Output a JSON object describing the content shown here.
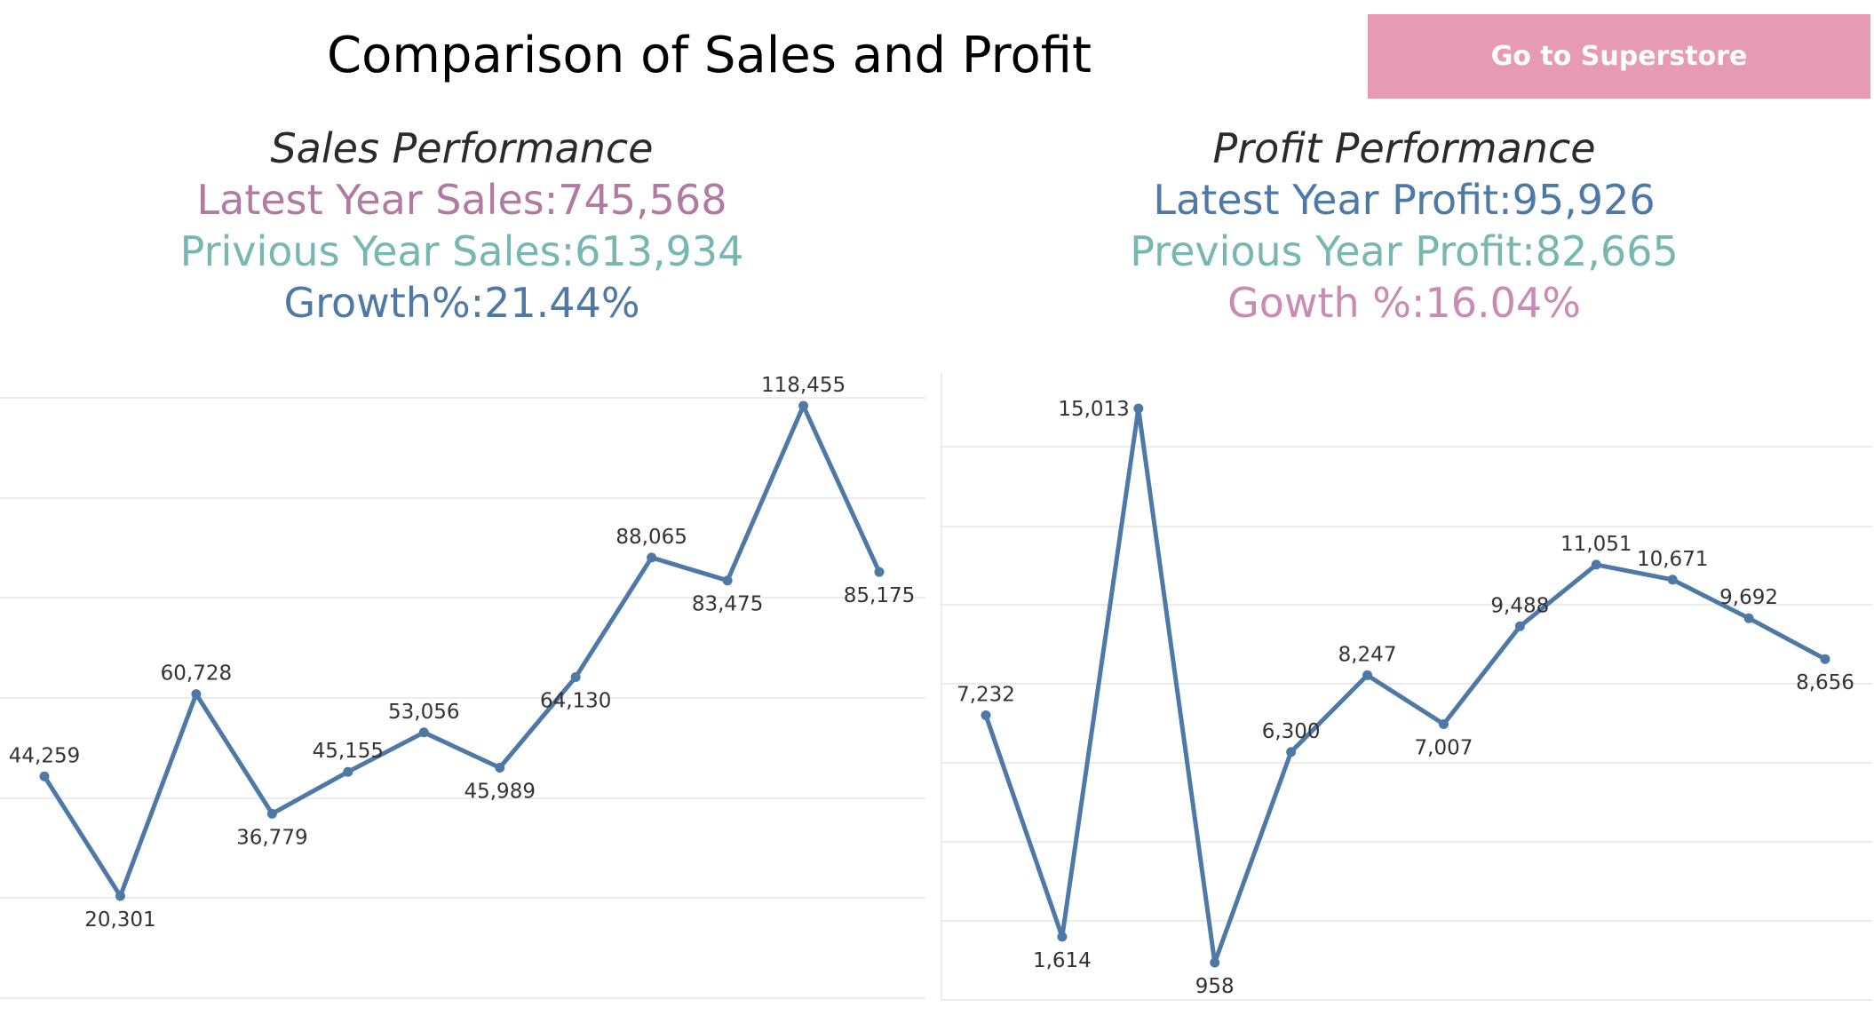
{
  "title": "Comparison of Sales and Profit",
  "nav_button": {
    "label": "Go to Superstore"
  },
  "colors": {
    "line": "#4e79a7",
    "pink": "#b07aa1",
    "teal": "#76b7b2",
    "blue": "#4e79a7",
    "light_pink": "#c98bb4",
    "button": "#e79ab3",
    "grid": "#e6e6e6"
  },
  "sales": {
    "heading": "Sales Performance",
    "latest": "Latest Year Sales:745,568",
    "previous": "Privious Year Sales:613,934",
    "growth": "Growth%:21.44%"
  },
  "profit": {
    "heading": "Profit Performance",
    "latest": "Latest Year Profit:95,926",
    "previous": "Previous Year Profit:82,665",
    "growth": "Gowth %:16.04%"
  },
  "chart_data": [
    {
      "type": "line",
      "values": [
        44259,
        20301,
        60728,
        36779,
        45155,
        53056,
        45989,
        64130,
        88065,
        83475,
        118455,
        85175
      ],
      "labels": [
        "44,259",
        "20,301",
        "60,728",
        "36,779",
        "45,155",
        "53,056",
        "45,989",
        "64,130",
        "88,065",
        "83,475",
        "118,455",
        "85,175"
      ],
      "label_positions": [
        "above",
        "below",
        "above",
        "below",
        "above",
        "above",
        "below",
        "below",
        "above",
        "below",
        "above",
        "below"
      ],
      "ylim": [
        0,
        125000
      ],
      "grid": true
    },
    {
      "type": "line",
      "values": [
        7232,
        1614,
        15013,
        958,
        6300,
        8247,
        7007,
        9488,
        11051,
        10671,
        9692,
        8656
      ],
      "labels": [
        "7,232",
        "1,614",
        "15,013",
        "958",
        "6,300",
        "8,247",
        "7,007",
        "9,488",
        "11,051",
        "10,671",
        "9,692",
        "8,656"
      ],
      "label_positions": [
        "above",
        "below",
        "left",
        "below",
        "above",
        "above",
        "below",
        "above",
        "above",
        "above",
        "above",
        "below"
      ],
      "ylim": [
        0,
        16000
      ],
      "grid": true
    }
  ]
}
